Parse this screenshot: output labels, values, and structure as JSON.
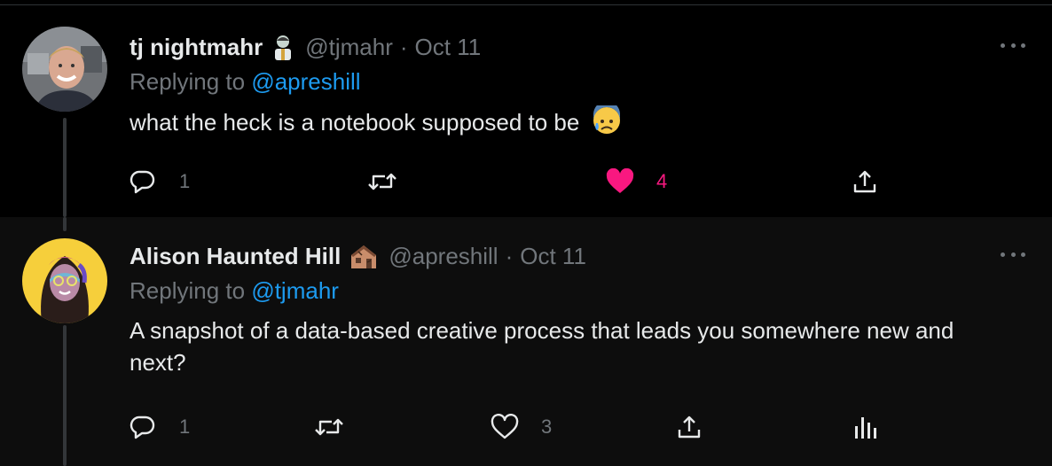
{
  "tweets": [
    {
      "display_name": "tj nightmahr",
      "name_emoji": "zombie-emoji",
      "handle": "@tjmahr",
      "separator": "·",
      "date": "Oct 11",
      "replying_prefix": "Replying to",
      "replying_to": "@apreshill",
      "text": "what the heck is a notebook supposed to be",
      "text_emoji": "anxious-face-with-sweat-emoji",
      "replies": "1",
      "retweets": "",
      "likes": "4",
      "liked": true
    },
    {
      "display_name": "Alison Haunted Hill",
      "name_emoji": "derelict-house-emoji",
      "handle": "@apreshill",
      "separator": "·",
      "date": "Oct 11",
      "replying_prefix": "Replying to",
      "replying_to": "@tjmahr",
      "text": "A snapshot of a data-based creative process that leads you somewhere new and next?",
      "replies": "1",
      "retweets": "",
      "likes": "3",
      "liked": false
    }
  ],
  "colors": {
    "background": "#000000",
    "background_alt": "#0d0d0d",
    "text_primary": "#e7e9ea",
    "text_secondary": "#71767b",
    "link": "#1d9bf0",
    "like": "#f91880",
    "divider": "#2f3336"
  }
}
